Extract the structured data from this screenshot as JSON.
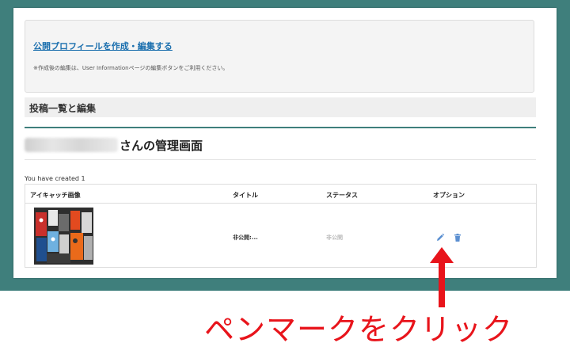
{
  "profile": {
    "link_text": "公開プロフィールを作成・編集する",
    "note": "※作成後の編集は、User Informationページの編集ボタンをご利用ください。"
  },
  "section": {
    "title": "投稿一覧と編集"
  },
  "admin": {
    "title_suffix": "さんの管理画面"
  },
  "posts": {
    "created_count": "You have created 1",
    "columns": [
      "アイキャッチ画像",
      "タイトル",
      "ステータス",
      "オプション"
    ],
    "rows": [
      {
        "title": "非公開:...",
        "status": "非公開"
      }
    ]
  },
  "icons": {
    "edit": "pencil-icon",
    "delete": "trash-icon"
  },
  "annotation": {
    "caption": "ペンマークをクリック"
  },
  "colors": {
    "frame": "#3f7f7c",
    "link": "#1b6fae",
    "annotation": "#e8141b",
    "icon": "#5b8fd1"
  }
}
